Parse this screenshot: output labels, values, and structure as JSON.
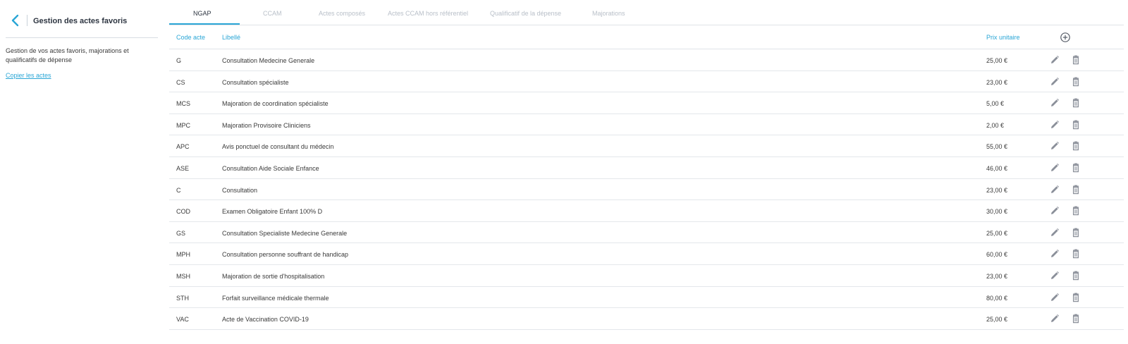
{
  "sidebar": {
    "title": "Gestion des actes favoris",
    "description": "Gestion de vos actes favoris, majorations et qualificatifs de dépense",
    "copy_link": "Copier les actes"
  },
  "tabs": [
    {
      "label": "NGAP",
      "active": true
    },
    {
      "label": "CCAM",
      "active": false
    },
    {
      "label": "Actes composés",
      "active": false
    },
    {
      "label": "Actes CCAM hors référentiel",
      "active": false
    },
    {
      "label": "Qualificatif de la dépense",
      "active": false
    },
    {
      "label": "Majorations",
      "active": false
    }
  ],
  "table": {
    "headers": {
      "code": "Code acte",
      "libelle": "Libellé",
      "price": "Prix unitaire"
    },
    "rows": [
      {
        "code": "G",
        "libelle": "Consultation Medecine Generale",
        "price": "25,00 €"
      },
      {
        "code": "CS",
        "libelle": "Consultation spécialiste",
        "price": "23,00 €"
      },
      {
        "code": "MCS",
        "libelle": "Majoration de coordination spécialiste",
        "price": "5,00 €"
      },
      {
        "code": "MPC",
        "libelle": "Majoration Provisoire Cliniciens",
        "price": "2,00 €"
      },
      {
        "code": "APC",
        "libelle": "Avis ponctuel de consultant du médecin",
        "price": "55,00 €"
      },
      {
        "code": "ASE",
        "libelle": "Consultation Aide Sociale Enfance",
        "price": "46,00 €"
      },
      {
        "code": "C",
        "libelle": "Consultation",
        "price": "23,00 €"
      },
      {
        "code": "COD",
        "libelle": "Examen Obligatoire Enfant 100% D",
        "price": "30,00 €"
      },
      {
        "code": "GS",
        "libelle": "Consultation Specialiste Medecine Generale",
        "price": "25,00 €"
      },
      {
        "code": "MPH",
        "libelle": "Consultation personne souffrant de handicap",
        "price": "60,00 €"
      },
      {
        "code": "MSH",
        "libelle": "Majoration de sortie d'hospitalisation",
        "price": "23,00 €"
      },
      {
        "code": "STH",
        "libelle": "Forfait surveillance médicale thermale",
        "price": "80,00 €"
      },
      {
        "code": "VAC",
        "libelle": "Acte de Vaccination COVID-19",
        "price": "25,00 €"
      }
    ]
  },
  "icons": {
    "back": "chevron-left-icon",
    "add": "plus-circle-icon",
    "edit": "pencil-icon",
    "delete": "trash-icon"
  },
  "colors": {
    "accent": "#2aa6d6",
    "text": "#3a3a3a",
    "tab_inactive": "#b8bfc8",
    "icon": "#8a8f99"
  }
}
